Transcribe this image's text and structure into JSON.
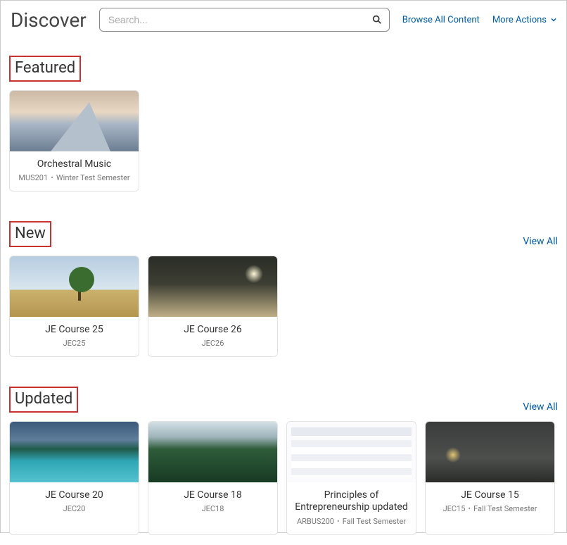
{
  "header": {
    "title": "Discover",
    "search_placeholder": "Search...",
    "browse_link": "Browse All Content",
    "more_actions": "More Actions"
  },
  "sections": {
    "featured": {
      "title": "Featured",
      "view_all": "",
      "cards": [
        {
          "title": "Orchestral Music",
          "code": "MUS201",
          "term": "Winter Test Semester",
          "thumb": "mountain"
        }
      ]
    },
    "new": {
      "title": "New",
      "view_all": "View All",
      "cards": [
        {
          "title": "JE Course 25",
          "code": "JEC25",
          "term": "",
          "thumb": "tree"
        },
        {
          "title": "JE Course 26",
          "code": "JEC26",
          "term": "",
          "thumb": "bridge"
        }
      ]
    },
    "updated": {
      "title": "Updated",
      "view_all": "View All",
      "cards": [
        {
          "title": "JE Course 20",
          "code": "JEC20",
          "term": "",
          "thumb": "lake"
        },
        {
          "title": "JE Course 18",
          "code": "JEC18",
          "term": "",
          "thumb": "forest"
        },
        {
          "title": "Principles of Entrepreneurship updated",
          "code": "ARBUS200",
          "term": "Fall Test Semester",
          "thumb": "table"
        },
        {
          "title": "JE Course 15",
          "code": "JEC15",
          "term": "Fall Test Semester",
          "thumb": "rain"
        }
      ]
    }
  }
}
